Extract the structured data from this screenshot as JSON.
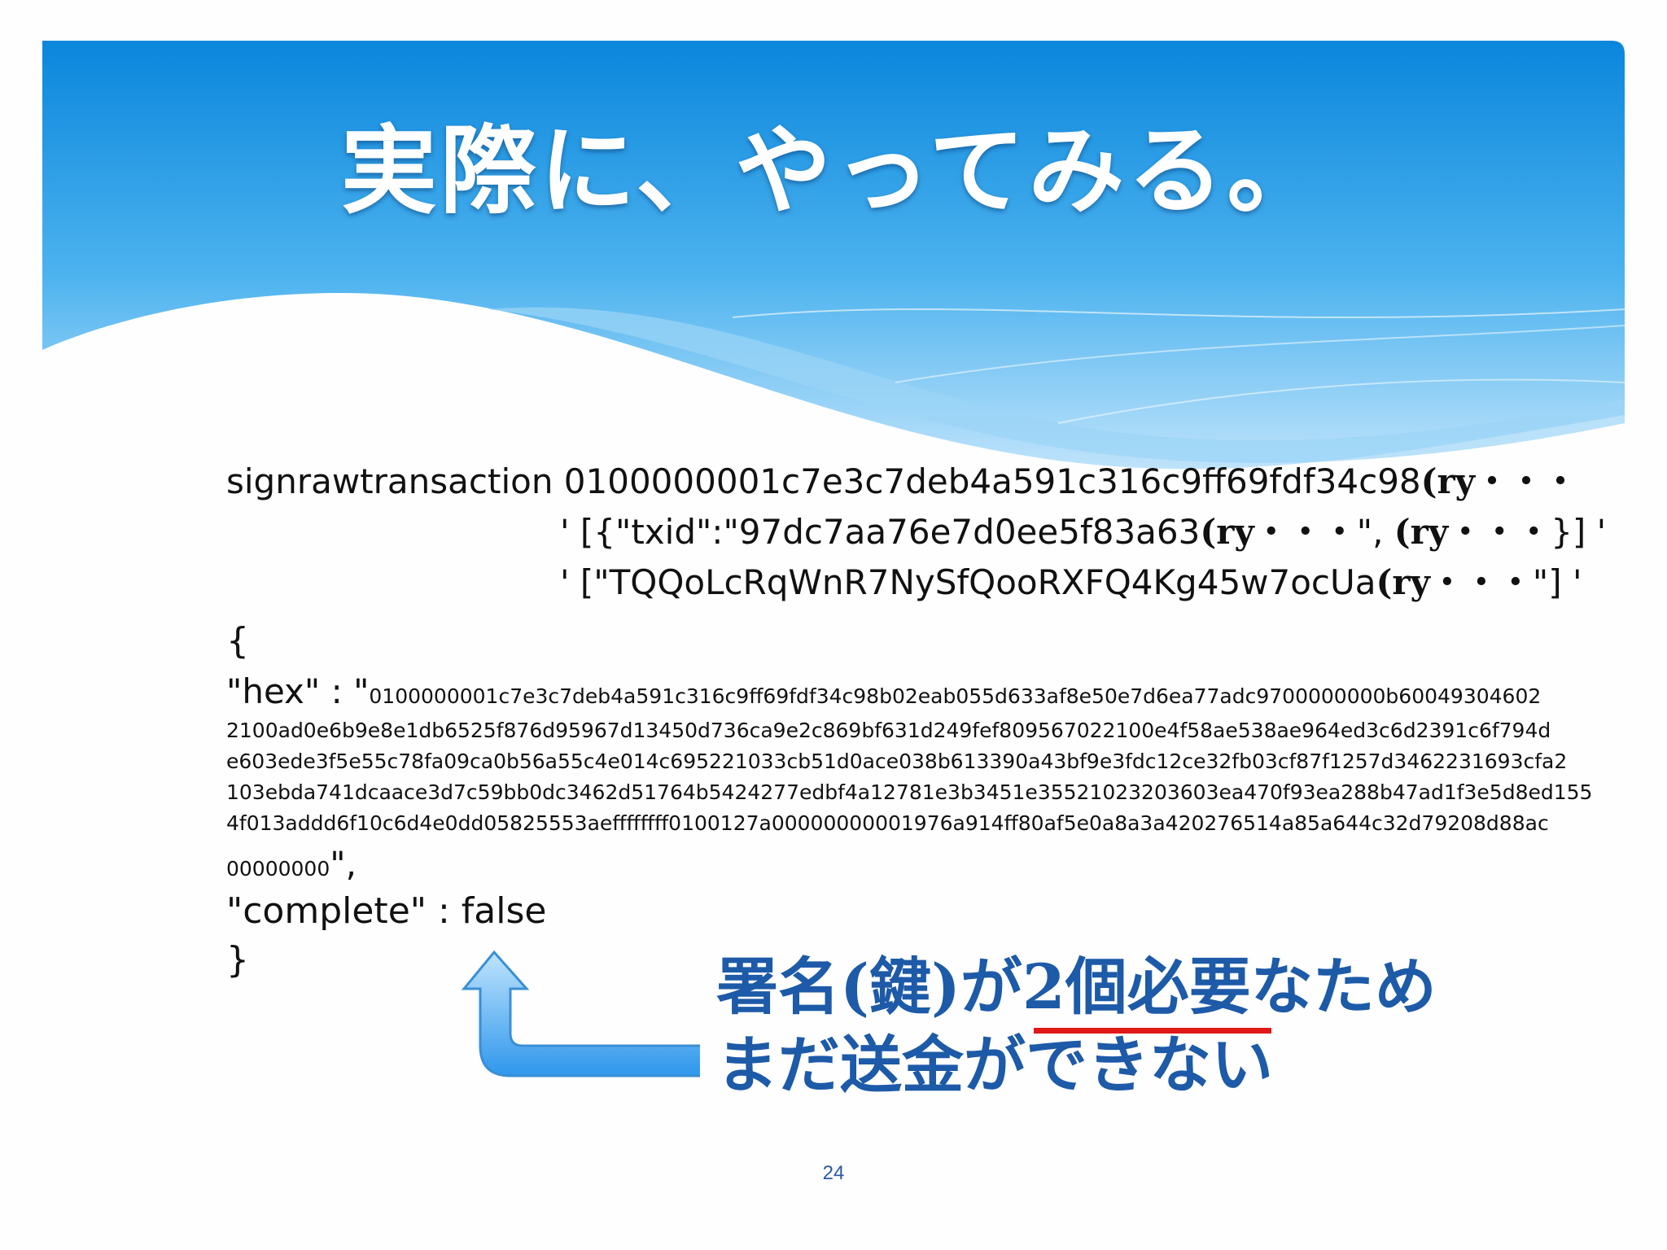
{
  "title": "実際に、やってみる。",
  "code": {
    "cmd_prefix": "signrawtransaction 0100000001c7e3c7deb4a591c316c9ff69fdf34c98",
    "cmd_ry": "(ry・・・",
    "arg1_prefix": "' [{\"txid\":\"97dc7aa76e7d0ee5f83a63",
    "arg1_ry1": "(ry・・・",
    "arg1_mid": "\", ",
    "arg1_ry2": "(ry・・・",
    "arg1_suffix": "}] '",
    "arg2_prefix": "' [\"TQQoLcRqWnR7NySfQooRXFQ4Kg45w7ocUa",
    "arg2_ry": "(ry・・・",
    "arg2_suffix": "\"] '",
    "open_brace": "{",
    "hex_key": "\"hex\" : \"",
    "hex_lines": [
      "0100000001c7e3c7deb4a591c316c9ff69fdf34c98b02eab055d633af8e50e7d6ea77adc9700000000b60049304602",
      "2100ad0e6b9e8e1db6525f876d95967d13450d736ca9e2c869bf631d249fef809567022100e4f58ae538ae964ed3c6d2391c6f794d",
      "e603ede3f5e55c78fa09ca0b56a55c4e014c695221033cb51d0ace038b613390a43bf9e3fdc12ce32fb03cf87f1257d3462231693cfa2",
      "103ebda741dcaace3d7c59bb0dc3462d51764b5424277edbf4a12781e3b3451e35521023203603ea470f93ea288b47ad1f3e5d8ed155",
      "4f013addd6f10c6d4e0dd05825553aeffffffff0100127a00000000001976a914ff80af5e0a8a3a420276514a85a644c32d79208d88ac",
      "00000000"
    ],
    "hex_end": "\",",
    "complete_line": "\"complete\" : false",
    "close_brace": "}"
  },
  "note": {
    "line1_a": "署名(鍵)が",
    "line1_b": "2個必要",
    "line1_c": "なため",
    "line2": "まだ送金ができない"
  },
  "page_number": "24",
  "colors": {
    "header_blue": "#1a8fe0",
    "note_blue": "#1d5aa8",
    "underline_red": "#e01818",
    "arrow_blue": "#3aa0f0"
  }
}
